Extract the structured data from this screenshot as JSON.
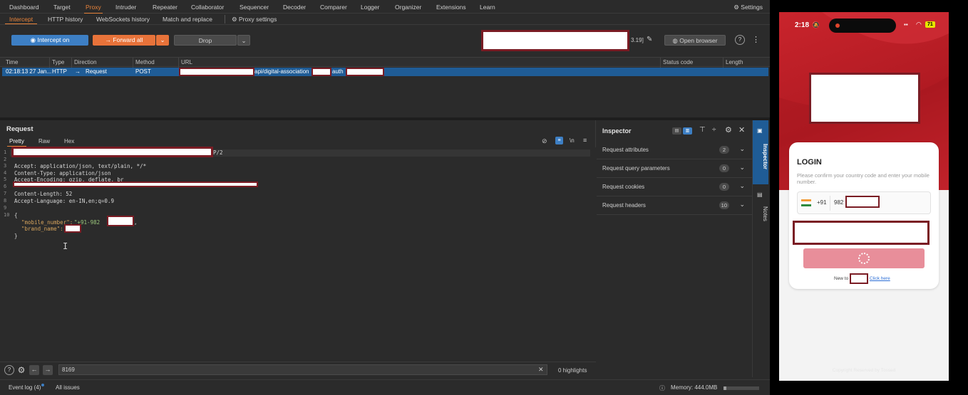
{
  "burp": {
    "nav": {
      "tabs": [
        "Dashboard",
        "Target",
        "Proxy",
        "Intruder",
        "Repeater",
        "Collaborator",
        "Sequencer",
        "Decoder",
        "Comparer",
        "Logger",
        "Organizer",
        "Extensions",
        "Learn"
      ],
      "active": "Proxy",
      "settings": "Settings"
    },
    "subnav": {
      "tabs": [
        "Intercept",
        "HTTP history",
        "WebSockets history",
        "Match and replace"
      ],
      "proxy_settings": "Proxy settings"
    },
    "toolbar": {
      "intercept": "Intercept on",
      "forward": "Forward all",
      "drop": "Drop",
      "host_suffix": "3.19]",
      "open_browser": "Open browser"
    },
    "table": {
      "columns": [
        "Time",
        "Type",
        "Direction",
        "Method",
        "URL",
        "Status code",
        "Length"
      ],
      "row": {
        "time": "02:18:13 27 Jan...",
        "type": "HTTP",
        "direction": "Request",
        "method": "POST",
        "url_mid": "api/digital-association",
        "url_end": "auth"
      }
    },
    "request": {
      "title": "Request",
      "tabs": [
        "Pretty",
        "Raw",
        "Hex"
      ],
      "line1_suffix": "P/2",
      "headers": [
        "Accept: application/json, text/plain, */*",
        "Content-Type: application/json",
        "Accept-Encoding: gzip, deflate, br",
        "Content-Length: 52",
        "Accept-Language: en-IN,en;q=0.9"
      ],
      "body_open": "{",
      "body_key1": "\"mobile_number\":",
      "body_val1": "\"+91-982",
      "body_key2": "\"brand_name\":",
      "body_close": "}",
      "line_numbers": [
        "1",
        "2",
        "3",
        "4",
        "5",
        "6",
        "7",
        "8",
        "9",
        "10"
      ]
    },
    "search": {
      "value": "8169",
      "highlights": "0 highlights"
    },
    "inspector": {
      "title": "Inspector",
      "rows": [
        {
          "label": "Request attributes",
          "count": "2"
        },
        {
          "label": "Request query parameters",
          "count": "0"
        },
        {
          "label": "Request cookies",
          "count": "0"
        },
        {
          "label": "Request headers",
          "count": "10"
        }
      ],
      "side_tabs": [
        "Inspector",
        "Notes"
      ]
    },
    "status": {
      "event_log": "Event log (4)",
      "all_issues": "All issues",
      "memory": "Memory: 444.0MB"
    }
  },
  "phone": {
    "time": "2:18",
    "battery": "71",
    "login_title": "LOGIN",
    "login_hint": "Please confirm your country code and enter your mobile number.",
    "country_code": "+91",
    "number_prefix": "982",
    "new_to": "New to",
    "click_here": "Click here",
    "footer": "Copyright Reserved by Tossed"
  },
  "colors": {
    "accent": "#e8833a",
    "intercept_blue": "#3d7fc4",
    "selected_row": "#1f5c96",
    "brand_red": "#c9242c",
    "redaction_border": "#7a1c24"
  }
}
